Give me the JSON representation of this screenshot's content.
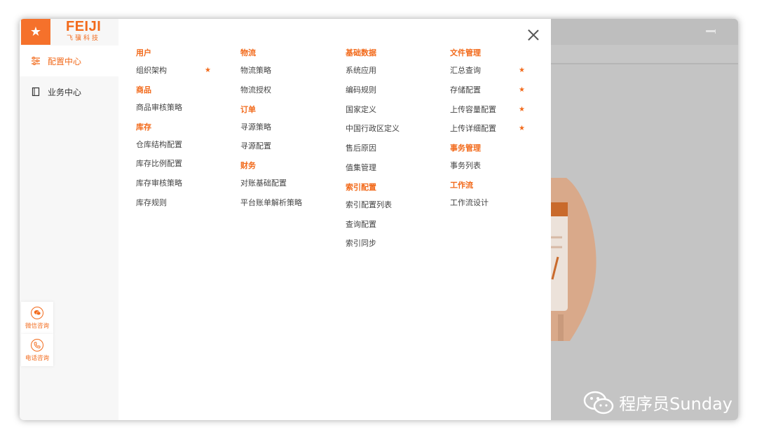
{
  "brand": {
    "name": "FEIJI",
    "subtitle": "飞骥科技",
    "accent": "#f26a1b"
  },
  "sidebar": {
    "items": [
      {
        "label": "配置中心",
        "icon": "sliders-icon",
        "active": true
      },
      {
        "label": "业务中心",
        "icon": "book-icon",
        "active": false
      }
    ],
    "contacts": [
      {
        "label": "微信咨询",
        "icon": "wechat-icon"
      },
      {
        "label": "电话咨询",
        "icon": "phone-icon"
      }
    ]
  },
  "menu": {
    "columns": [
      {
        "groups": [
          {
            "title": "用户",
            "items": [
              {
                "label": "组织架构",
                "starred": true
              }
            ]
          },
          {
            "title": "商品",
            "items": [
              {
                "label": "商品审核策略",
                "starred": false
              }
            ]
          },
          {
            "title": "库存",
            "items": [
              {
                "label": "仓库结构配置",
                "starred": false
              },
              {
                "label": "库存比例配置",
                "starred": false
              },
              {
                "label": "库存审核策略",
                "starred": false
              },
              {
                "label": "库存规则",
                "starred": false
              }
            ]
          }
        ]
      },
      {
        "groups": [
          {
            "title": "物流",
            "items": [
              {
                "label": "物流策略",
                "starred": false
              },
              {
                "label": "物流授权",
                "starred": false
              }
            ]
          },
          {
            "title": "订单",
            "items": [
              {
                "label": "寻源策略",
                "starred": false
              },
              {
                "label": "寻源配置",
                "starred": false
              }
            ]
          },
          {
            "title": "财务",
            "items": [
              {
                "label": "对账基础配置",
                "starred": false
              },
              {
                "label": "平台账单解析策略",
                "starred": false
              }
            ]
          }
        ]
      },
      {
        "groups": [
          {
            "title": "基础数据",
            "items": [
              {
                "label": "系统应用",
                "starred": false
              },
              {
                "label": "编码规则",
                "starred": false
              },
              {
                "label": "国家定义",
                "starred": false
              },
              {
                "label": "中国行政区定义",
                "starred": false
              },
              {
                "label": "售后原因",
                "starred": false
              },
              {
                "label": "值集管理",
                "starred": false
              }
            ]
          },
          {
            "title": "索引配置",
            "items": [
              {
                "label": "索引配置列表",
                "starred": false
              },
              {
                "label": "查询配置",
                "starred": false
              },
              {
                "label": "索引同步",
                "starred": false
              }
            ]
          }
        ]
      },
      {
        "groups": [
          {
            "title": "文件管理",
            "items": [
              {
                "label": "汇总查询",
                "starred": true
              },
              {
                "label": "存储配置",
                "starred": true
              },
              {
                "label": "上传容量配置",
                "starred": true
              },
              {
                "label": "上传详细配置",
                "starred": true
              }
            ]
          },
          {
            "title": "事务管理",
            "items": [
              {
                "label": "事务列表",
                "starred": false
              }
            ]
          },
          {
            "title": "工作流",
            "items": [
              {
                "label": "工作流设计",
                "starred": false
              }
            ]
          }
        ]
      }
    ]
  },
  "watermark": {
    "text": "程序员Sunday",
    "icon": "wechat-icon"
  }
}
